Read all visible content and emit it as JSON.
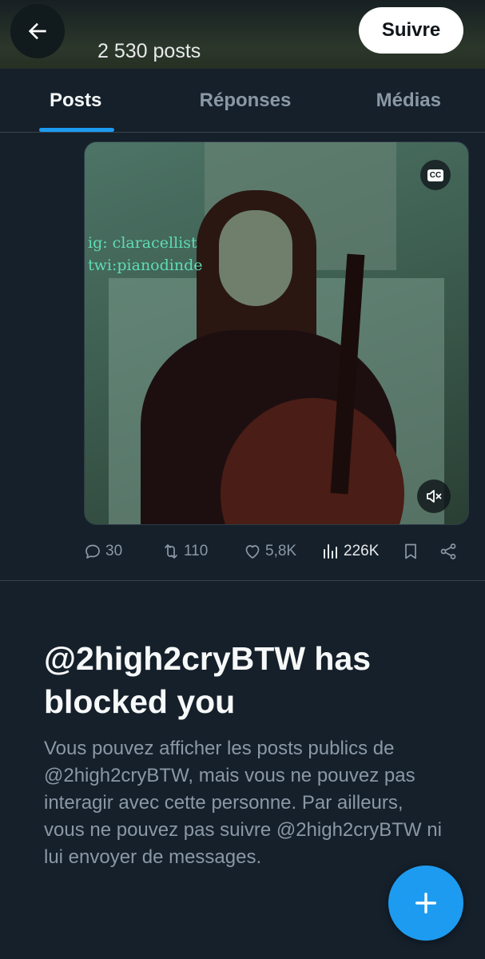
{
  "header": {
    "post_count": "2 530 posts",
    "follow_label": "Suivre",
    "back_icon": "arrow-left-icon"
  },
  "tabs": [
    {
      "label": "Posts",
      "active": true
    },
    {
      "label": "Réponses",
      "active": false
    },
    {
      "label": "Médias",
      "active": false
    }
  ],
  "post": {
    "media_overlay_lines": [
      "ig: claracellist",
      "twi:pianodinde"
    ],
    "cc_label": "CC",
    "stats": {
      "replies": "30",
      "reposts": "110",
      "likes": "5,8K",
      "views": "226K"
    }
  },
  "blocked": {
    "title": "@2high2cryBTW has blocked you",
    "description": "Vous pouvez afficher les posts publics de @2high2cryBTW, mais vous ne pouvez pas interagir avec cette personne. Par ailleurs, vous ne pouvez pas suivre @2high2cryBTW ni lui envoyer de messages."
  },
  "colors": {
    "background": "#15202b",
    "accent": "#1d9bf0",
    "muted_text": "#8b98a5",
    "divider": "#38444d"
  }
}
